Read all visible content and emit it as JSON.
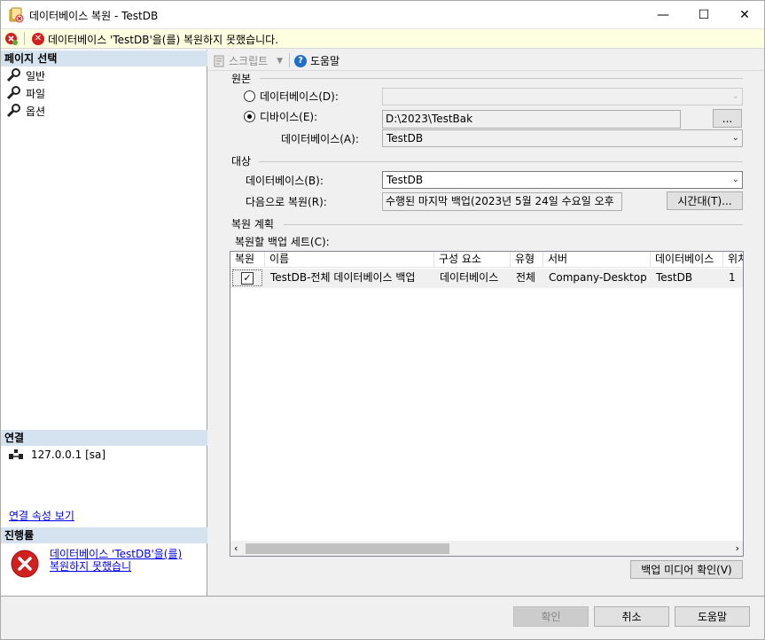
{
  "window": {
    "title": "데이터베이스 복원 - TestDB",
    "controls": {
      "minimize": "—",
      "maximize": "☐",
      "close": "✕"
    }
  },
  "error_bar": {
    "message": "데이터베이스 'TestDB'을(를) 복원하지 못했습니다."
  },
  "left_pane": {
    "select_page_heading": "페이지 선택",
    "pages": [
      {
        "label": "일반",
        "icon": "wrench-icon"
      },
      {
        "label": "파일",
        "icon": "wrench-icon"
      },
      {
        "label": "옵션",
        "icon": "wrench-icon"
      }
    ],
    "connection_heading": "연결",
    "connection_value": "127.0.0.1 [sa]",
    "connection_link": "연결 속성 보기",
    "progress_heading": "진행률",
    "progress_message": "데이터베이스 'TestDB'을(를) 복원하지 못했습니"
  },
  "toolbar": {
    "script_label": "스크립트",
    "help_label": "도움말"
  },
  "source": {
    "title": "원본",
    "database_label": "데이터베이스(D):",
    "database_value": "",
    "device_label": "디바이스(E):",
    "device_value": "D:\\2023\\TestBak",
    "browse_label": "...",
    "device_database_label": "데이터베이스(A):",
    "device_database_value": "TestDB",
    "selected": "device"
  },
  "destination": {
    "title": "대상",
    "database_label": "데이터베이스(B):",
    "database_value": "TestDB",
    "restore_to_label": "다음으로 복원(R):",
    "restore_to_value": "수행된 마지막 백업(2023년 5월 24일 수요일 오후",
    "timeline_label": "시간대(T)..."
  },
  "restore_plan": {
    "title": "복원 계획",
    "backup_sets_label": "복원할 백업 세트(C):",
    "columns": [
      "복원",
      "이름",
      "구성 요소",
      "유형",
      "서버",
      "데이터베이스",
      "위치"
    ],
    "rows": [
      {
        "restore": true,
        "name": "TestDB-전체 데이터베이스 백업",
        "component": "데이터베이스",
        "type": "전체",
        "server": "Company-Desktop",
        "database": "TestDB",
        "position": "1"
      }
    ],
    "verify_button": "백업 미디어 확인(V)"
  },
  "footer": {
    "ok": "확인",
    "cancel": "취소",
    "help": "도움말"
  },
  "colors": {
    "error_red": "#d02020",
    "error_bar_bg": "#ffffe1",
    "section_head_bg": "#d5e2f0",
    "link": "#0000ee"
  }
}
